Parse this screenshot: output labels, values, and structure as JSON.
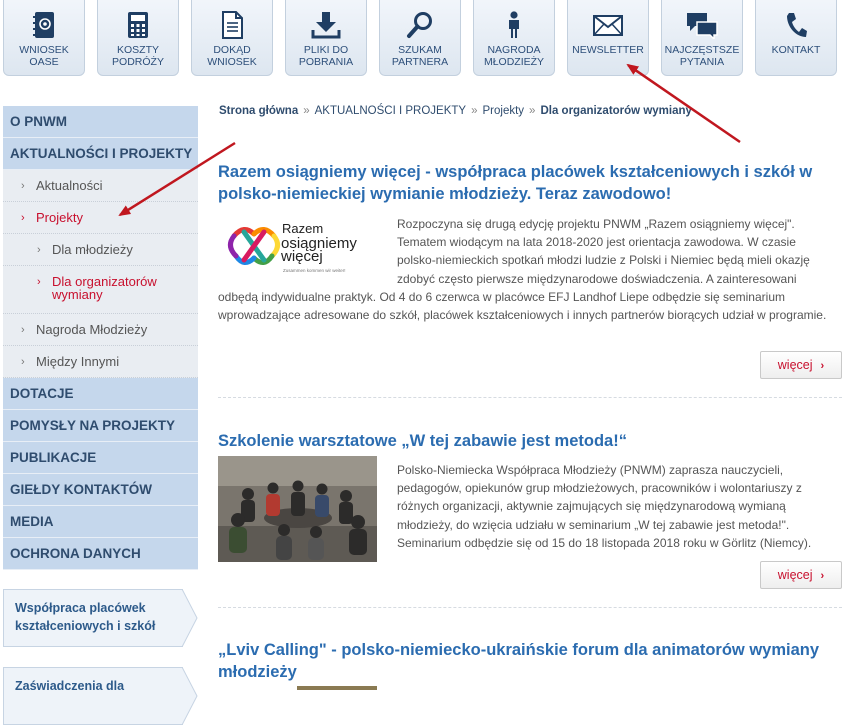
{
  "top_nav": [
    {
      "label": "WNIOSEK\nOASE",
      "icon": "notebook-icon"
    },
    {
      "label": "KOSZTY\nPODRÓŻY",
      "icon": "calculator-icon"
    },
    {
      "label": "DOKĄD\nWNIOSEK",
      "icon": "document-icon"
    },
    {
      "label": "PLIKI DO\nPOBRANIA",
      "icon": "download-icon"
    },
    {
      "label": "SZUKAM\nPARTNERA",
      "icon": "magnifier-icon"
    },
    {
      "label": "NAGRODA\nMŁODZIEŻY",
      "icon": "person-icon"
    },
    {
      "label": "NEWSLETTER",
      "icon": "envelope-icon"
    },
    {
      "label": "NAJCZĘSTSZE\nPYTANIA",
      "icon": "speech-bubbles-icon"
    },
    {
      "label": "KONTAKT",
      "icon": "phone-icon"
    }
  ],
  "sidebar": {
    "items": [
      {
        "label": "O PNWM"
      },
      {
        "label": "AKTUALNOŚCI I PROJEKTY"
      },
      {
        "label": "Aktualności"
      },
      {
        "label": "Projekty"
      },
      {
        "label": "Dla młodzieży"
      },
      {
        "label": "Dla organizatorów\nwymiany"
      },
      {
        "label": "Nagroda Młodzieży"
      },
      {
        "label": "Między Innymi"
      },
      {
        "label": "DOTACJE"
      },
      {
        "label": "POMYSŁY NA PROJEKTY"
      },
      {
        "label": "PUBLIKACJE"
      },
      {
        "label": "GIEŁDY KONTAKTÓW"
      },
      {
        "label": "MEDIA"
      },
      {
        "label": "OCHRONA DANYCH"
      }
    ],
    "chevron": "›",
    "promos": [
      {
        "label": "Współpraca placówek\nkształceniowych i szkół"
      },
      {
        "label": "Zaświadczenia dla"
      }
    ]
  },
  "breadcrumb": {
    "home": "Strona główna",
    "sep": "»",
    "level1": "AKTUALNOŚCI I PROJEKTY",
    "level2": "Projekty",
    "current": "Dla organizatorów wymiany"
  },
  "articles": [
    {
      "title": "Razem osiągniemy więcej - współpraca placówek kształceniowych i szkół w polsko-niemieckiej wymianie młodzieży. Teraz zawodowo!",
      "logo": {
        "line1": "Razem",
        "line2": "osiągniemy",
        "line3": "więcej",
        "small": "Zusammen kommen wir weiter!"
      },
      "text": "Rozpoczyna się drugą edycję projektu PNWM „Razem osiągniemy więcej\". Tematem wiodącym na lata 2018-2020 jest orientacja zawodowa. W czasie polsko-niemieckich spotkań młodzi ludzie z Polski i Niemiec będą mieli okazję zdobyć często pierwsze międzynarodowe doświadczenia. A zainteresowani odbędą indywidualne praktyk. Od 4 do 6 czerwca w placówce EFJ Landhof Liepe odbędzie się seminarium wprowadzające adresowane do szkół, placówek kształceniowych i innych partnerów biorących udział w programie.",
      "more": "więcej"
    },
    {
      "title": "Szkolenie warsztatowe „W tej zabawie jest metoda!“",
      "text": "Polsko-Niemiecka Współpraca Młodzieży (PNWM) zaprasza nauczycieli, pedagogów, opiekunów grup młodzieżowych, pracowników i wolontariuszy z różnych organizacji, aktywnie zajmujących się międzynarodową wymianą młodzieży, do wzięcia udziału w seminarium „W tej zabawie jest metoda!\". Seminarium odbędzie się od 15 do 18 listopada 2018 roku w Görlitz (Niemcy).",
      "more": "więcej"
    },
    {
      "title": "„Lviv Calling\" - polsko-niemiecko-ukraińskie forum dla animatorów wymiany młodzieży"
    }
  ],
  "colors": {
    "accent_red": "#c8102e",
    "link_blue": "#2b6cb0",
    "nav_blue": "#c5d7ec",
    "annotation_arrow": "#c0171f"
  }
}
